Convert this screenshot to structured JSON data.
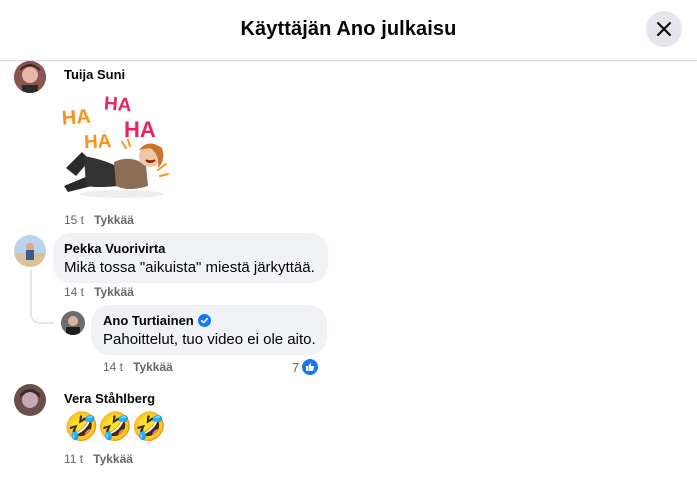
{
  "header": {
    "title": "Käyttäjän Ano julkaisu",
    "close_icon": "close-icon"
  },
  "comments": [
    {
      "author": "Tuija Suni",
      "sticker_text": [
        "HA",
        "HA",
        "HA",
        "HA"
      ],
      "time": "15 t",
      "like_label": "Tykkää"
    },
    {
      "author": "Pekka Vuorivirta",
      "text": "Mikä tossa \"aikuista\" miestä järkyttää.",
      "time": "14 t",
      "like_label": "Tykkää",
      "reply": {
        "author": "Ano Turtiainen",
        "verified": true,
        "text": "Pahoittelut, tuo video ei ole aito.",
        "time": "14 t",
        "like_label": "Tykkää",
        "reaction_count": "7",
        "reaction_icon": "like-icon"
      }
    },
    {
      "author": "Vera Ståhlberg",
      "text": "🤣🤣🤣",
      "time": "11 t",
      "like_label": "Tykkää"
    }
  ],
  "colors": {
    "link_blue": "#1877f2",
    "bubble": "#f0f2f5",
    "meta": "#65676b",
    "ha_orange": "#f7941d",
    "ha_pink": "#e8245d"
  }
}
